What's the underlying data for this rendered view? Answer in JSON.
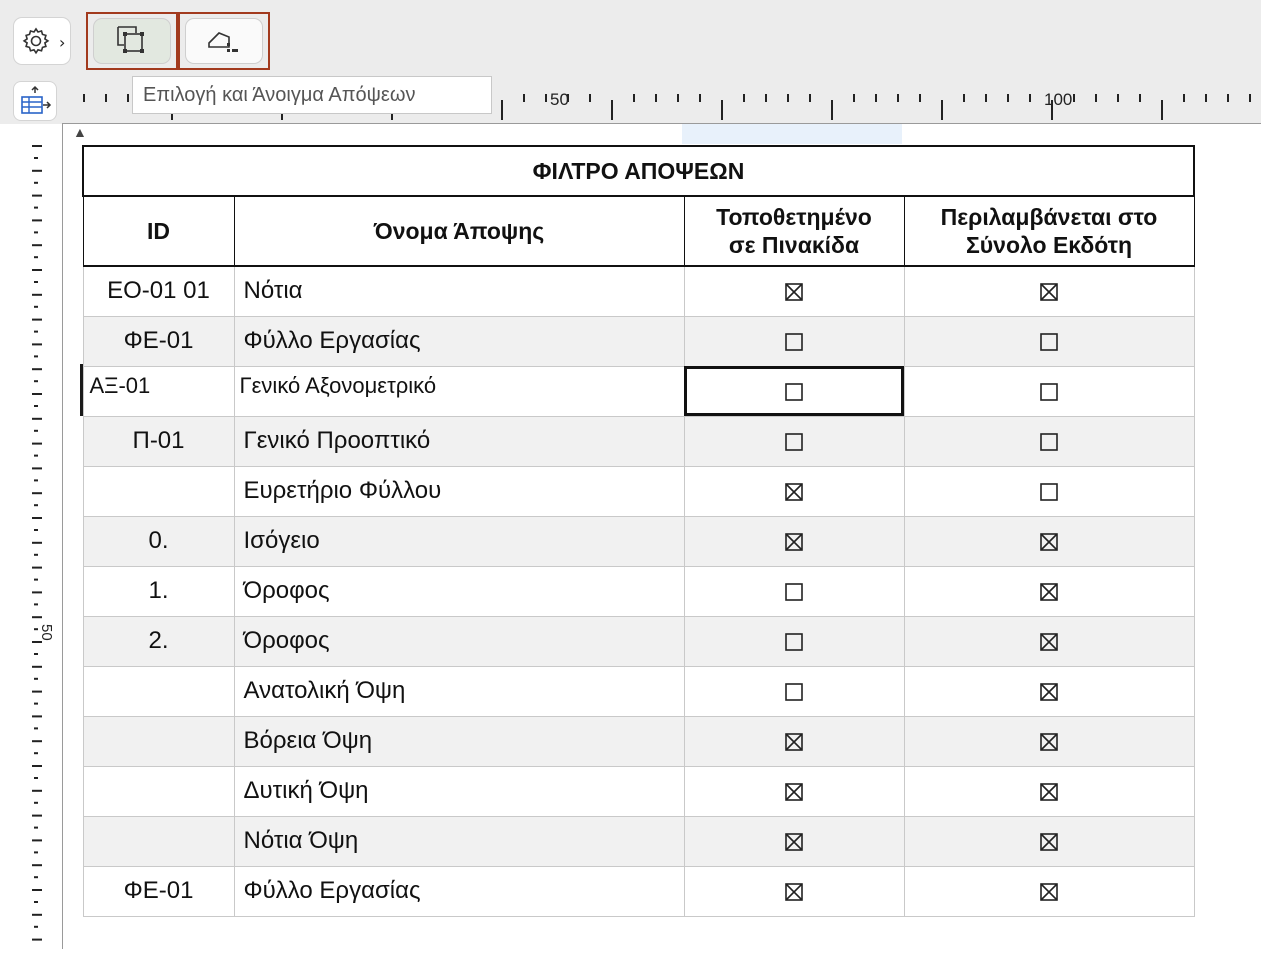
{
  "toolbar": {
    "tooltip": "Επιλογή και Άνοιγμα Απόψεων",
    "icons": [
      "gear-icon",
      "chevron-right-icon",
      "select-view-icon",
      "view-map-icon",
      "table-view-icon"
    ]
  },
  "ruler": {
    "h_labels": [
      "50",
      "100"
    ],
    "v_labels": [
      "50"
    ]
  },
  "schedule": {
    "title": "ΦΙΛΤΡΟ ΑΠΟΨΕΩΝ",
    "columns": {
      "id": "ID",
      "name": "Όνομα Άποψης",
      "placed_1": "Τοποθετημένο",
      "placed_2": "σε Πινακίδα",
      "pub_1": "Περιλαμβάνεται στο",
      "pub_2": "Σύνολο Εκδότη"
    },
    "rows": [
      {
        "id": "ΕΟ-01 01",
        "name": "Νότια",
        "placed": true,
        "pub": true
      },
      {
        "id": "ΦΕ-01",
        "name": "Φύλλο Εργασίας",
        "placed": false,
        "pub": false
      },
      {
        "id": "ΑΞ-01",
        "name": "Γενικό Αξονομετρικό",
        "placed": false,
        "pub": false
      },
      {
        "id": "Π-01",
        "name": "Γενικό Προοπτικό",
        "placed": false,
        "pub": false
      },
      {
        "id": "",
        "name": "Ευρετήριο Φύλλου",
        "placed": true,
        "pub": false
      },
      {
        "id": "0.",
        "name": "Ισόγειο",
        "placed": true,
        "pub": true
      },
      {
        "id": "1.",
        "name": "Όροφος",
        "placed": false,
        "pub": true
      },
      {
        "id": "2.",
        "name": "Όροφος",
        "placed": false,
        "pub": true
      },
      {
        "id": "",
        "name": "Ανατολική Όψη",
        "placed": false,
        "pub": true
      },
      {
        "id": "",
        "name": "Βόρεια Όψη",
        "placed": true,
        "pub": true
      },
      {
        "id": "",
        "name": "Δυτική Όψη",
        "placed": true,
        "pub": true
      },
      {
        "id": "",
        "name": "Νότια Όψη",
        "placed": true,
        "pub": true
      },
      {
        "id": "ΦΕ-01",
        "name": "Φύλλο Εργασίας",
        "placed": true,
        "pub": true
      }
    ]
  }
}
